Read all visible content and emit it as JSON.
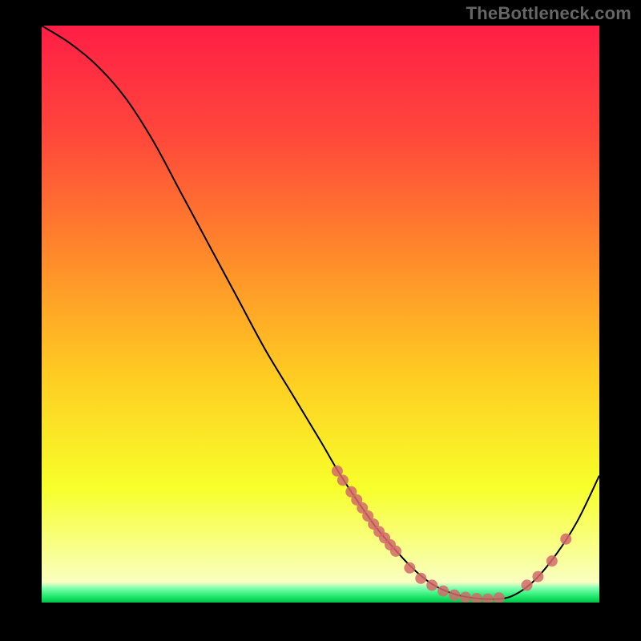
{
  "watermark": "TheBottleneck.com",
  "chart_data": {
    "type": "line",
    "title": "",
    "xlabel": "",
    "ylabel": "",
    "xlim": [
      0,
      100
    ],
    "ylim": [
      0,
      100
    ],
    "grid": false,
    "series": [
      {
        "name": "curve",
        "x": [
          0,
          5,
          10,
          15,
          20,
          25,
          30,
          35,
          40,
          45,
          50,
          53,
          56,
          60,
          64,
          67,
          70,
          73,
          76,
          80,
          84,
          88,
          92,
          96,
          100
        ],
        "y": [
          100,
          97,
          93,
          87.5,
          80,
          71,
          62,
          53,
          44,
          36,
          28,
          23,
          18.5,
          13,
          8.5,
          5.5,
          3.2,
          1.8,
          1.0,
          0.6,
          1.0,
          3.5,
          8.0,
          14,
          22
        ]
      }
    ],
    "scatter": {
      "name": "markers",
      "color": "#d46a6a",
      "points": [
        {
          "x": 53,
          "y": 22.8
        },
        {
          "x": 54,
          "y": 21.2
        },
        {
          "x": 55.5,
          "y": 19.2
        },
        {
          "x": 56.5,
          "y": 17.8
        },
        {
          "x": 57.5,
          "y": 16.4
        },
        {
          "x": 58.5,
          "y": 15.0
        },
        {
          "x": 59.5,
          "y": 13.6
        },
        {
          "x": 60.5,
          "y": 12.3
        },
        {
          "x": 61.5,
          "y": 11.2
        },
        {
          "x": 62.5,
          "y": 10.0
        },
        {
          "x": 63.5,
          "y": 8.9
        },
        {
          "x": 66,
          "y": 6.0
        },
        {
          "x": 68,
          "y": 4.2
        },
        {
          "x": 70,
          "y": 3.0
        },
        {
          "x": 72,
          "y": 2.0
        },
        {
          "x": 74,
          "y": 1.3
        },
        {
          "x": 76,
          "y": 0.9
        },
        {
          "x": 78,
          "y": 0.7
        },
        {
          "x": 80,
          "y": 0.6
        },
        {
          "x": 82,
          "y": 0.8
        },
        {
          "x": 87,
          "y": 3.0
        },
        {
          "x": 89,
          "y": 4.5
        },
        {
          "x": 91.5,
          "y": 7.2
        },
        {
          "x": 94,
          "y": 11.0
        }
      ]
    },
    "background_gradient": {
      "stops": [
        {
          "offset": 0.0,
          "color": "#ff1e46"
        },
        {
          "offset": 0.2,
          "color": "#ff4a3a"
        },
        {
          "offset": 0.4,
          "color": "#ff8a2a"
        },
        {
          "offset": 0.6,
          "color": "#ffca22"
        },
        {
          "offset": 0.8,
          "color": "#f7ff2a"
        },
        {
          "offset": 0.965,
          "color": "#f9ffc0"
        },
        {
          "offset": 0.975,
          "color": "#7fffb0"
        },
        {
          "offset": 0.99,
          "color": "#1ee86a"
        },
        {
          "offset": 1.0,
          "color": "#00c24d"
        }
      ]
    }
  }
}
